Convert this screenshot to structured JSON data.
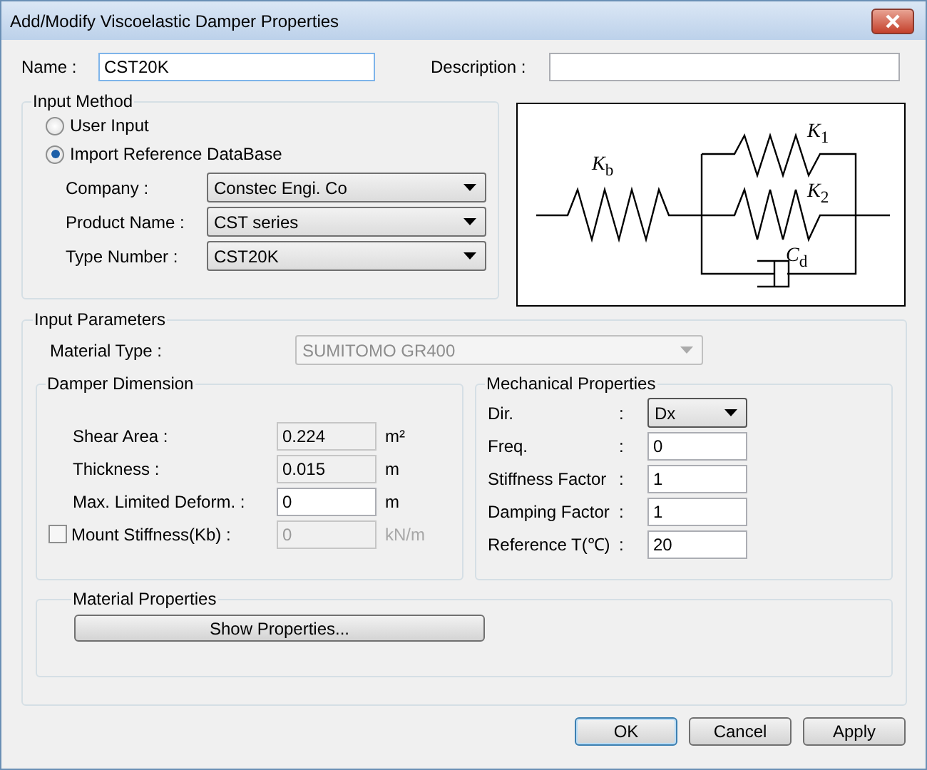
{
  "window": {
    "title": "Add/Modify Viscoelastic Damper Properties"
  },
  "name_field": {
    "label": "Name :",
    "value": "CST20K"
  },
  "description_field": {
    "label": "Description :"
  },
  "input_method": {
    "title": "Input Method",
    "options": [
      {
        "label": "User Input",
        "selected": false
      },
      {
        "label": "Import Reference DataBase",
        "selected": true
      }
    ],
    "selects": [
      {
        "label": "Company :",
        "value": "Constec Engi. Co"
      },
      {
        "label": "Product Name :",
        "value": "CST series"
      },
      {
        "label": "Type Number :",
        "value": "CST20K"
      }
    ]
  },
  "diagram": {
    "labels": [
      "*K*$_{b}$",
      "*K*$_{1}$",
      "*K*$_{2}$",
      "*C*$_{d}$"
    ]
  },
  "input_parameters": {
    "title": "Input Parameters",
    "material_type": {
      "label": "Material Type :",
      "value": "SUMITOMO GR400",
      "disabled": true
    },
    "damper_dimension": {
      "title": "Damper Dimension",
      "rows": [
        {
          "kind": "readonly",
          "label": "Shear Area :",
          "value": "0.224",
          "unit": "m²"
        },
        {
          "kind": "readonly",
          "label": "Thickness  :",
          "value": "0.015",
          "unit": "m"
        },
        {
          "kind": "input",
          "label": "Max. Limited Deform. :",
          "value": "0",
          "unit": "m"
        },
        {
          "kind": "checkbox",
          "label": "Mount Stiffness(Kb) :",
          "checked": false,
          "value": "0",
          "unit": "kN/m",
          "disabled": true
        }
      ]
    },
    "mechanical_properties": {
      "title": "Mechanical Properties",
      "rows": [
        {
          "kind": "select",
          "label": "Dir.",
          "colon": ":",
          "value": "Dx"
        },
        {
          "kind": "input",
          "label": "Freq.",
          "colon": ":",
          "value": "0"
        },
        {
          "kind": "input",
          "label": "Stiffness Factor",
          "colon": ":",
          "value": "1"
        },
        {
          "kind": "input",
          "label": "Damping Factor",
          "colon": ":",
          "value": "1"
        },
        {
          "kind": "input",
          "label": "Reference T(℃)",
          "colon": ":",
          "value": "20"
        }
      ]
    },
    "material_properties": {
      "title": "Material Properties",
      "button": "Show Properties..."
    }
  },
  "buttons": [
    {
      "label": "OK",
      "default": true
    },
    {
      "label": "Cancel",
      "default": false
    },
    {
      "label": "Apply",
      "default": false
    }
  ]
}
